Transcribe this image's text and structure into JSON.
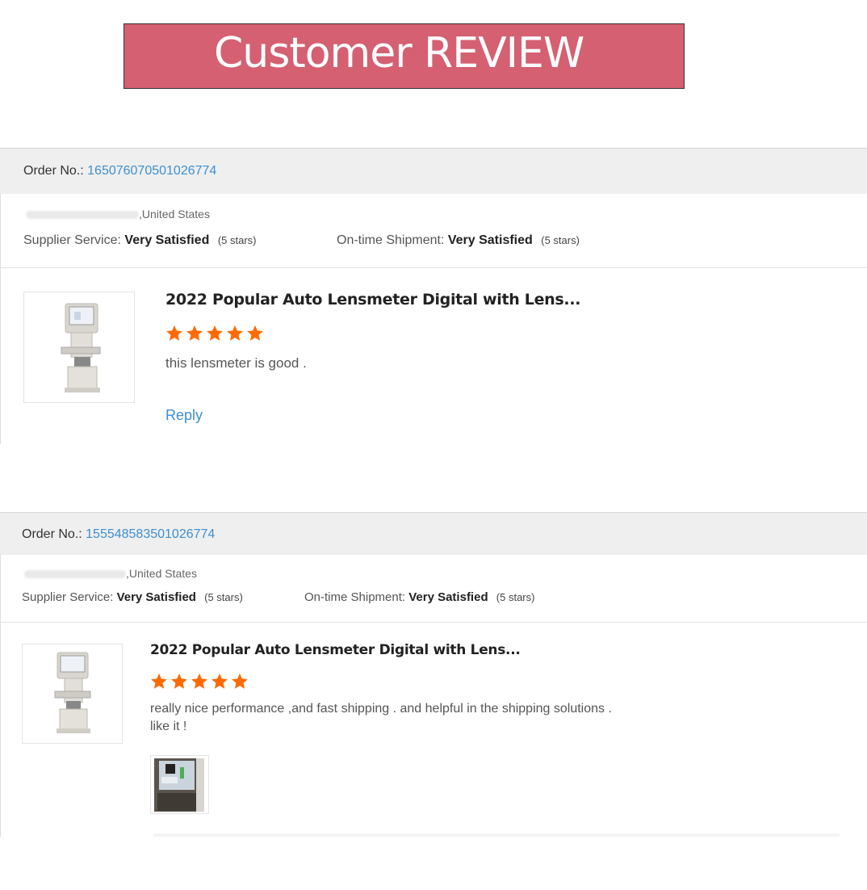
{
  "banner": {
    "title": "Customer REVIEW",
    "bg_color": "#d46072"
  },
  "reviews": [
    {
      "order_label": "Order No.:",
      "order_no": "165076070501026774",
      "buyer_country": ",United States",
      "supplier_label": "Supplier Service:",
      "supplier_value": "Very Satisfied",
      "supplier_stars": "(5 stars)",
      "shipment_label": "On-time Shipment:",
      "shipment_value": "Very Satisfied",
      "shipment_stars": "(5 stars)",
      "product_title": "2022 Popular Auto Lensmeter Digital with Lens...",
      "rating": 5,
      "comment": "this lensmeter is good .",
      "reply_label": "Reply"
    },
    {
      "order_label": "Order No.:",
      "order_no": "155548583501026774",
      "buyer_country": ",United States",
      "supplier_label": "Supplier Service:",
      "supplier_value": "Very Satisfied",
      "supplier_stars": "(5 stars)",
      "shipment_label": "On-time Shipment:",
      "shipment_value": "Very Satisfied",
      "shipment_stars": "(5 stars)",
      "product_title": "2022 Popular Auto Lensmeter Digital with Lens...",
      "rating": 5,
      "comment_line1": "really nice performance ,and fast shipping . and helpful in the shipping solutions .",
      "comment_line2": "like it !"
    }
  ],
  "colors": {
    "link": "#3d8fd0",
    "star": "#ff6a00",
    "order_bar": "#efefef"
  },
  "icons": {
    "star": "star-icon"
  }
}
